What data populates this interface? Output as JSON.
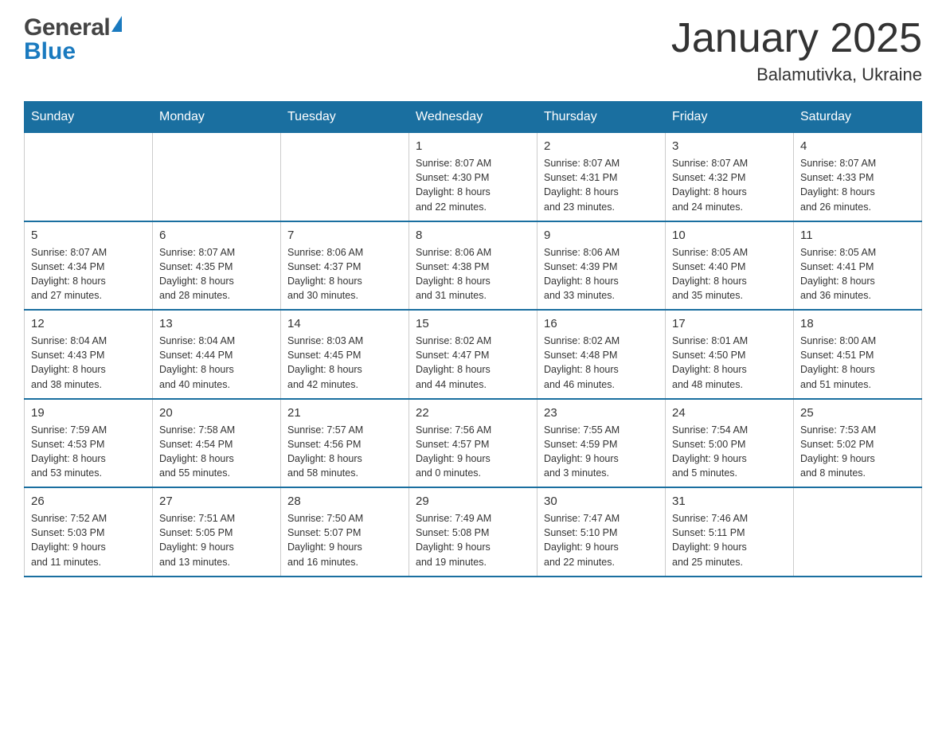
{
  "header": {
    "logo_general": "General",
    "logo_blue": "Blue",
    "title": "January 2025",
    "subtitle": "Balamutivka, Ukraine"
  },
  "days_of_week": [
    "Sunday",
    "Monday",
    "Tuesday",
    "Wednesday",
    "Thursday",
    "Friday",
    "Saturday"
  ],
  "weeks": [
    [
      {
        "day": "",
        "info": ""
      },
      {
        "day": "",
        "info": ""
      },
      {
        "day": "",
        "info": ""
      },
      {
        "day": "1",
        "info": "Sunrise: 8:07 AM\nSunset: 4:30 PM\nDaylight: 8 hours\nand 22 minutes."
      },
      {
        "day": "2",
        "info": "Sunrise: 8:07 AM\nSunset: 4:31 PM\nDaylight: 8 hours\nand 23 minutes."
      },
      {
        "day": "3",
        "info": "Sunrise: 8:07 AM\nSunset: 4:32 PM\nDaylight: 8 hours\nand 24 minutes."
      },
      {
        "day": "4",
        "info": "Sunrise: 8:07 AM\nSunset: 4:33 PM\nDaylight: 8 hours\nand 26 minutes."
      }
    ],
    [
      {
        "day": "5",
        "info": "Sunrise: 8:07 AM\nSunset: 4:34 PM\nDaylight: 8 hours\nand 27 minutes."
      },
      {
        "day": "6",
        "info": "Sunrise: 8:07 AM\nSunset: 4:35 PM\nDaylight: 8 hours\nand 28 minutes."
      },
      {
        "day": "7",
        "info": "Sunrise: 8:06 AM\nSunset: 4:37 PM\nDaylight: 8 hours\nand 30 minutes."
      },
      {
        "day": "8",
        "info": "Sunrise: 8:06 AM\nSunset: 4:38 PM\nDaylight: 8 hours\nand 31 minutes."
      },
      {
        "day": "9",
        "info": "Sunrise: 8:06 AM\nSunset: 4:39 PM\nDaylight: 8 hours\nand 33 minutes."
      },
      {
        "day": "10",
        "info": "Sunrise: 8:05 AM\nSunset: 4:40 PM\nDaylight: 8 hours\nand 35 minutes."
      },
      {
        "day": "11",
        "info": "Sunrise: 8:05 AM\nSunset: 4:41 PM\nDaylight: 8 hours\nand 36 minutes."
      }
    ],
    [
      {
        "day": "12",
        "info": "Sunrise: 8:04 AM\nSunset: 4:43 PM\nDaylight: 8 hours\nand 38 minutes."
      },
      {
        "day": "13",
        "info": "Sunrise: 8:04 AM\nSunset: 4:44 PM\nDaylight: 8 hours\nand 40 minutes."
      },
      {
        "day": "14",
        "info": "Sunrise: 8:03 AM\nSunset: 4:45 PM\nDaylight: 8 hours\nand 42 minutes."
      },
      {
        "day": "15",
        "info": "Sunrise: 8:02 AM\nSunset: 4:47 PM\nDaylight: 8 hours\nand 44 minutes."
      },
      {
        "day": "16",
        "info": "Sunrise: 8:02 AM\nSunset: 4:48 PM\nDaylight: 8 hours\nand 46 minutes."
      },
      {
        "day": "17",
        "info": "Sunrise: 8:01 AM\nSunset: 4:50 PM\nDaylight: 8 hours\nand 48 minutes."
      },
      {
        "day": "18",
        "info": "Sunrise: 8:00 AM\nSunset: 4:51 PM\nDaylight: 8 hours\nand 51 minutes."
      }
    ],
    [
      {
        "day": "19",
        "info": "Sunrise: 7:59 AM\nSunset: 4:53 PM\nDaylight: 8 hours\nand 53 minutes."
      },
      {
        "day": "20",
        "info": "Sunrise: 7:58 AM\nSunset: 4:54 PM\nDaylight: 8 hours\nand 55 minutes."
      },
      {
        "day": "21",
        "info": "Sunrise: 7:57 AM\nSunset: 4:56 PM\nDaylight: 8 hours\nand 58 minutes."
      },
      {
        "day": "22",
        "info": "Sunrise: 7:56 AM\nSunset: 4:57 PM\nDaylight: 9 hours\nand 0 minutes."
      },
      {
        "day": "23",
        "info": "Sunrise: 7:55 AM\nSunset: 4:59 PM\nDaylight: 9 hours\nand 3 minutes."
      },
      {
        "day": "24",
        "info": "Sunrise: 7:54 AM\nSunset: 5:00 PM\nDaylight: 9 hours\nand 5 minutes."
      },
      {
        "day": "25",
        "info": "Sunrise: 7:53 AM\nSunset: 5:02 PM\nDaylight: 9 hours\nand 8 minutes."
      }
    ],
    [
      {
        "day": "26",
        "info": "Sunrise: 7:52 AM\nSunset: 5:03 PM\nDaylight: 9 hours\nand 11 minutes."
      },
      {
        "day": "27",
        "info": "Sunrise: 7:51 AM\nSunset: 5:05 PM\nDaylight: 9 hours\nand 13 minutes."
      },
      {
        "day": "28",
        "info": "Sunrise: 7:50 AM\nSunset: 5:07 PM\nDaylight: 9 hours\nand 16 minutes."
      },
      {
        "day": "29",
        "info": "Sunrise: 7:49 AM\nSunset: 5:08 PM\nDaylight: 9 hours\nand 19 minutes."
      },
      {
        "day": "30",
        "info": "Sunrise: 7:47 AM\nSunset: 5:10 PM\nDaylight: 9 hours\nand 22 minutes."
      },
      {
        "day": "31",
        "info": "Sunrise: 7:46 AM\nSunset: 5:11 PM\nDaylight: 9 hours\nand 25 minutes."
      },
      {
        "day": "",
        "info": ""
      }
    ]
  ]
}
